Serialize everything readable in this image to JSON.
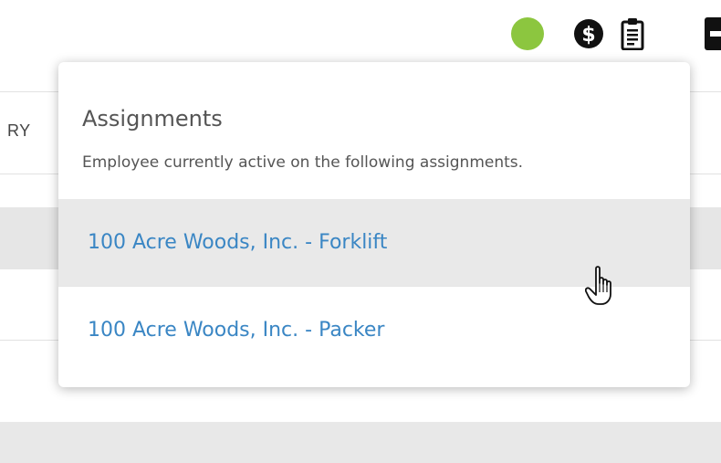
{
  "header": {
    "status_color": "#8cc63f",
    "icons": [
      "status-dot",
      "dollar-icon",
      "clipboard-icon",
      "cut-icon"
    ]
  },
  "background": {
    "column_header_fragment": "RY"
  },
  "popover": {
    "title": "Assignments",
    "subtitle": "Employee currently active on the following assignments.",
    "assignments": [
      {
        "label": "100 Acre Woods, Inc. - Forklift",
        "hovered": true
      },
      {
        "label": "100 Acre Woods, Inc. - Packer",
        "hovered": false
      }
    ],
    "link_color": "#3a86c4"
  }
}
